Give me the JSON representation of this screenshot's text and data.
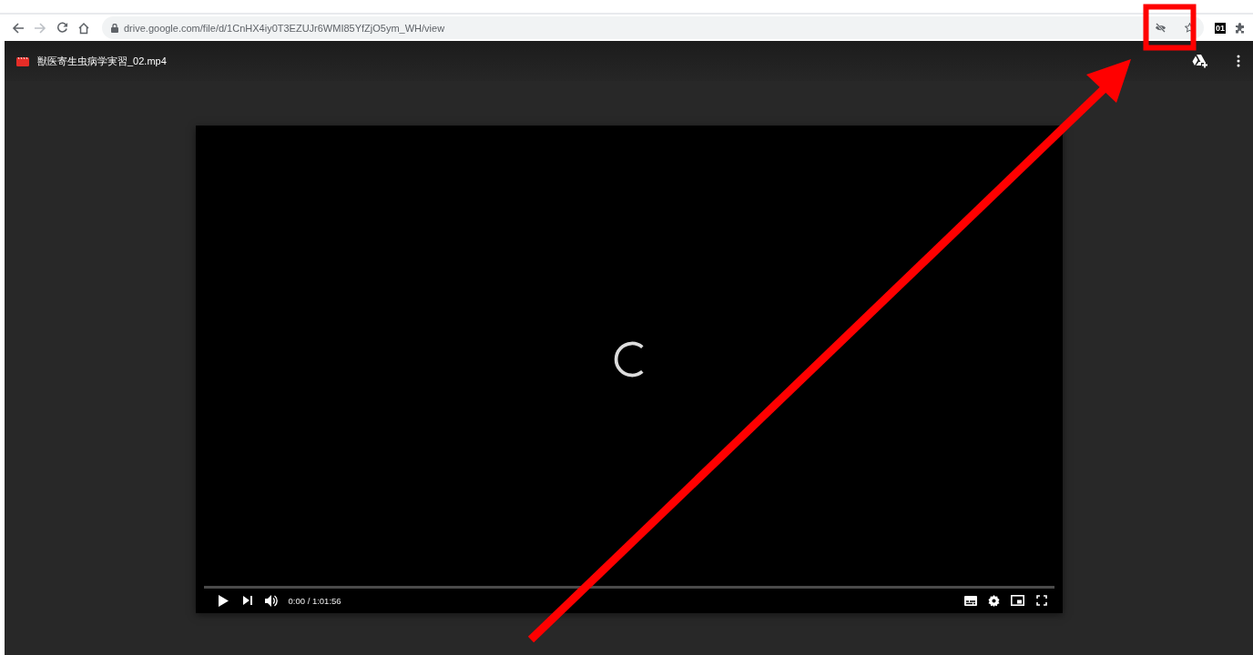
{
  "browser": {
    "url": "drive.google.com/file/d/1CnHX4iy0T3EZUJr6WMI85YfZjO5ym_WH/view",
    "extension_badge": "01"
  },
  "viewer": {
    "file_title": "獣医寄生虫病学実習_02.mp4"
  },
  "player": {
    "loading": true,
    "progress": {
      "level": 0
    },
    "time": "0:00 / 1:01:56"
  },
  "annotation": {
    "shown": true
  }
}
